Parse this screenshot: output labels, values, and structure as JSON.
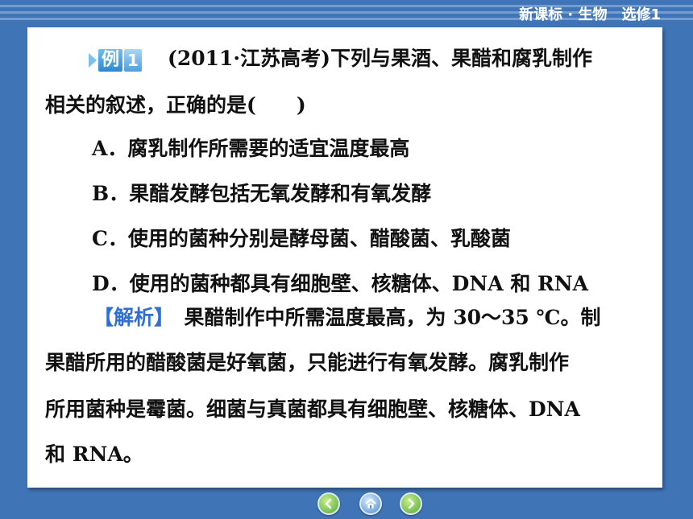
{
  "header": {
    "title": "新课标 · 生物　选修1"
  },
  "example": {
    "badge_word": "例",
    "badge_number": "1",
    "stem_line1": "(2011·江苏高考)下列与果酒、果醋和腐乳制作",
    "stem_line2": "相关的叙述，正确的是(　　)"
  },
  "options": [
    "A．腐乳制作所需要的适宜温度最高",
    "B．果醋发酵包括无氧发酵和有氧发酵",
    "C．使用的菌种分别是酵母菌、醋酸菌、乳酸菌",
    "D．使用的菌种都具有细胞壁、核糖体、DNA 和 RNA"
  ],
  "analysis": {
    "label": "【解析】",
    "line1": "　果醋制作中所需温度最高，为 30～35 ℃。制",
    "line2": "果醋所用的醋酸菌是好氧菌，只能进行有氧发酵。腐乳制作",
    "line3": "所用菌种是霉菌。细菌与真菌都具有细胞壁、核糖体、DNA",
    "line4": "和 RNA。"
  },
  "nav": {
    "prev_icon": "left-arrow-icon",
    "home_icon": "home-icon",
    "next_icon": "right-arrow-icon"
  },
  "colors": {
    "background": "#3f74b6",
    "panel": "#ffffff",
    "analysis_label": "#2e6fd6"
  }
}
